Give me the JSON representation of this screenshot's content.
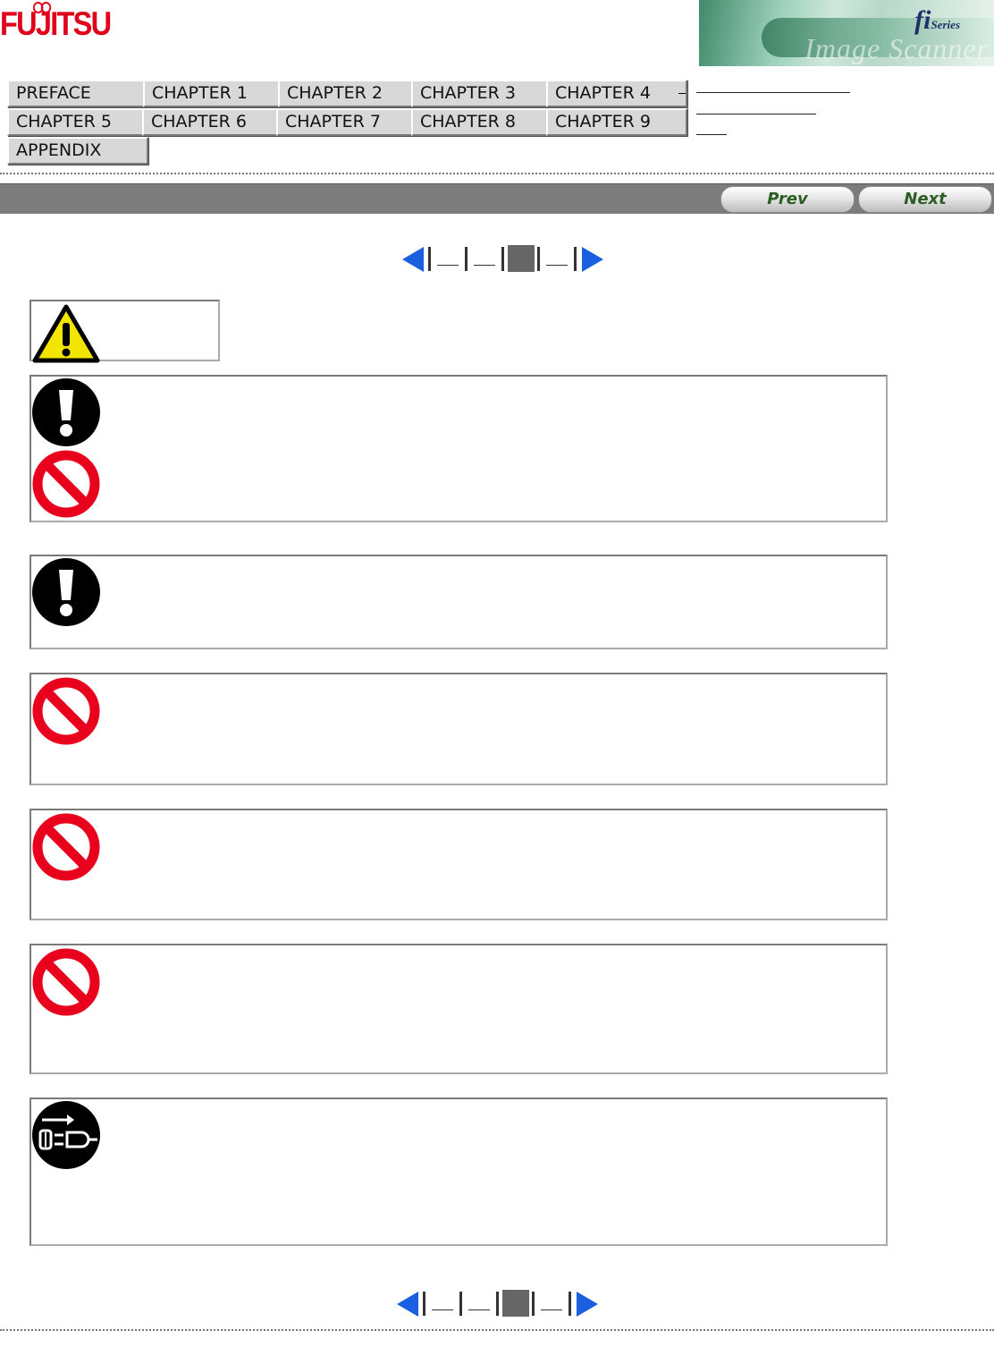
{
  "header": {
    "logo_text": "FUJITSU",
    "banner": {
      "brand_fi": "fi",
      "brand_series": "Series",
      "script_text": "Image Scanner"
    }
  },
  "tabs": [
    {
      "label": "PREFACE"
    },
    {
      "label": "CHAPTER 1"
    },
    {
      "label": "CHAPTER 2"
    },
    {
      "label": "CHAPTER 3"
    },
    {
      "label": "CHAPTER 4"
    },
    {
      "label": "CHAPTER 5"
    },
    {
      "label": "CHAPTER 6"
    },
    {
      "label": "CHAPTER 7"
    },
    {
      "label": "CHAPTER 8"
    },
    {
      "label": "CHAPTER 9"
    },
    {
      "label": "APPENDIX"
    }
  ],
  "nav": {
    "prev_label": "Prev",
    "next_label": "Next"
  },
  "pager": {
    "total_pages": 4,
    "current_page": 3
  },
  "warning_header": {
    "icon": "warning-triangle-icon"
  },
  "boxes": [
    {
      "icons": [
        "mandatory-action-icon",
        "prohibited-icon"
      ]
    },
    {
      "icons": [
        "mandatory-action-icon"
      ]
    },
    {
      "icons": [
        "prohibited-icon"
      ]
    },
    {
      "icons": [
        "prohibited-icon"
      ]
    },
    {
      "icons": [
        "prohibited-icon"
      ]
    },
    {
      "icons": [
        "unplug-power-icon"
      ]
    }
  ],
  "colors": {
    "logo_red": "#e0001a",
    "title_bar": "#7c7c7c",
    "nav_text": "#2c5e24",
    "pager_arrow": "#1a5fe0",
    "prohibited_red": "#e8001c",
    "warning_yellow": "#f2e600"
  }
}
